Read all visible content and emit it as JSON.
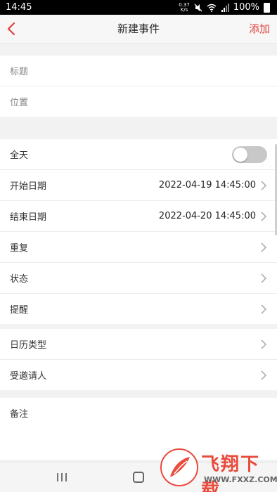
{
  "status_bar": {
    "time": "14:45",
    "speed_value": "0.37",
    "speed_unit": "K/s",
    "battery": "100%"
  },
  "nav": {
    "title": "新建事件",
    "add_label": "添加",
    "back_icon": "chevron-left-icon",
    "accent_color": "#e0403a"
  },
  "basic": {
    "title_placeholder": "标题",
    "location_placeholder": "位置"
  },
  "schedule": {
    "all_day_label": "全天",
    "all_day_on": false,
    "start_label": "开始日期",
    "start_value": "2022-04-19 14:45:00",
    "end_label": "结束日期",
    "end_value": "2022-04-20 14:45:00",
    "repeat_label": "重复",
    "status_label": "状态",
    "reminder_label": "提醒"
  },
  "extra": {
    "calendar_type_label": "日历类型",
    "invitees_label": "受邀请人"
  },
  "notes": {
    "label": "备注"
  },
  "watermark": {
    "text": "飞翔下载",
    "url": "WWW.FXXZ.COM"
  }
}
